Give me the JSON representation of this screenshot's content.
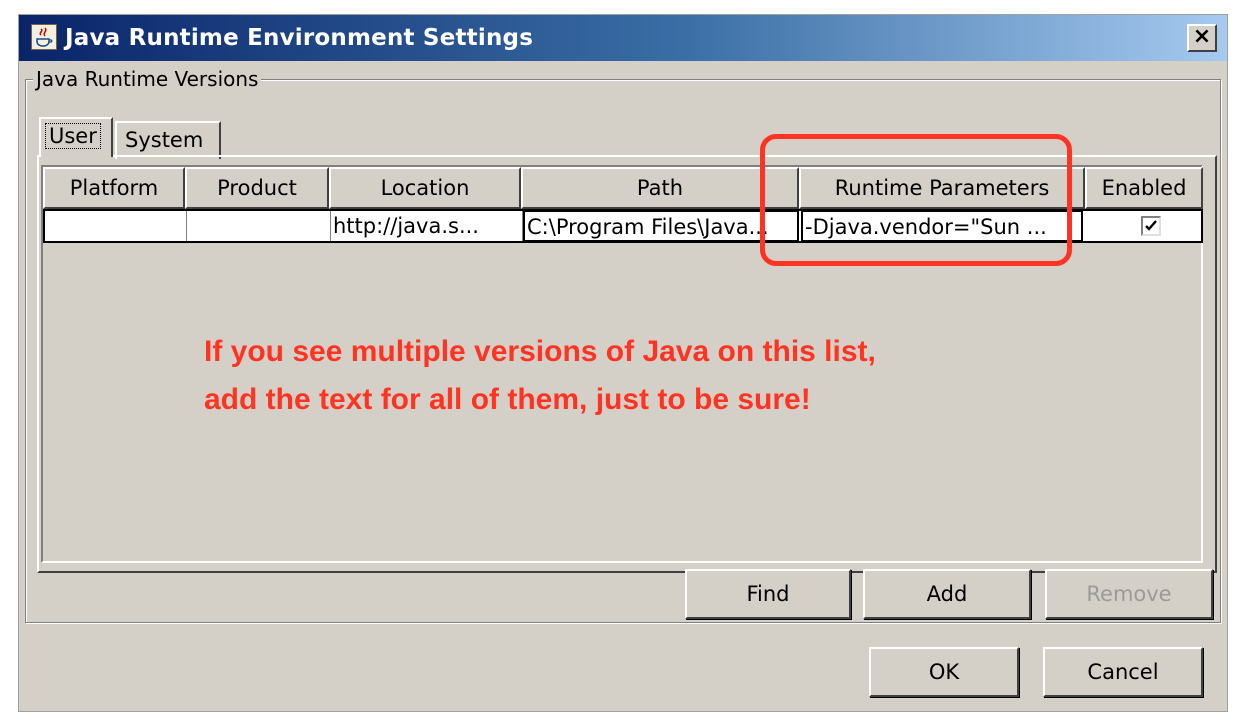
{
  "window": {
    "title": "Java Runtime Environment Settings",
    "close_label": "×"
  },
  "group": {
    "legend": "Java Runtime Versions"
  },
  "tabs": [
    {
      "label": "User",
      "selected": true
    },
    {
      "label": "System",
      "selected": false
    }
  ],
  "table": {
    "columns": [
      "Platform",
      "Product",
      "Location",
      "Path",
      "Runtime Parameters",
      "Enabled"
    ],
    "rows": [
      {
        "platform": "",
        "product": "",
        "location": "http://java.s...",
        "path": "C:\\Program Files\\Java...",
        "runtime_parameters": "-Djava.vendor=\"Sun ...",
        "enabled": true
      }
    ]
  },
  "annotation": {
    "line1": "If you see multiple versions of Java on this list,",
    "line2": "add the text for all of them, just to be sure!",
    "color": "#ff3322"
  },
  "buttons": {
    "find": "Find",
    "add": "Add",
    "remove": "Remove",
    "ok": "OK",
    "cancel": "Cancel"
  },
  "colors": {
    "title_start": "#0a246a",
    "title_end": "#a6caf0",
    "dialog_bg": "#d4d0c8"
  }
}
